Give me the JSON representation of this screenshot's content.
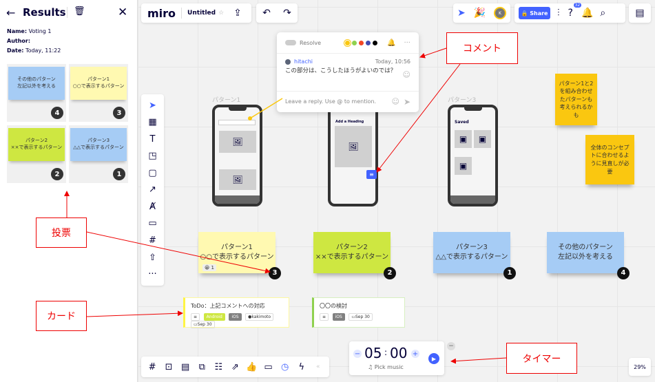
{
  "panel": {
    "title": "Results",
    "name_label": "Name:",
    "name_value": "Voting 1",
    "author_label": "Author:",
    "date_label": "Date:",
    "date_value": "Today, 11:22",
    "results": [
      {
        "text": "その他のパターン\n左記以外を考える",
        "rank": "4",
        "color": "#a6ccf5"
      },
      {
        "text": "パターン1\n○○で表示するパターン",
        "rank": "3",
        "color": "#fff9b1"
      },
      {
        "text": "パターン2\n××で表示するパターン",
        "rank": "2",
        "color": "#cee741"
      },
      {
        "text": "パターン3\n△△で表示するパターン",
        "rank": "1",
        "color": "#a6ccf5"
      }
    ]
  },
  "topbar": {
    "logo": "miro",
    "board_title": "Untitled",
    "share_label": "Share",
    "notification_count": "32",
    "avatar_initial": "K"
  },
  "comment": {
    "resolve_label": "Resolve",
    "colors": [
      "#fac710",
      "#8fd14f",
      "#f24726",
      "#414bb2",
      "#000000"
    ],
    "author": "hitachi",
    "time": "Today, 10:56",
    "text": "この部分は、こうしたほうがよいのでは？",
    "reply_placeholder": "Leave a reply. Use @ to mention."
  },
  "phones": {
    "label1": "パターン1",
    "label3": "パターン3",
    "heading2": "Add a Heading",
    "heading3": "Saved"
  },
  "stickies": [
    {
      "text": "パターン1\n○○で表示するパターン",
      "rank": "3",
      "color": "#fff9b1",
      "reaction": "1"
    },
    {
      "text": "パターン2\n××で表示するパターン",
      "rank": "2",
      "color": "#cee741"
    },
    {
      "text": "パターン3\n△△で表示するパターン",
      "rank": "1",
      "color": "#a6ccf5"
    },
    {
      "text": "その他のパターン\n左記以外を考える",
      "rank": "4",
      "color": "#a6ccf5"
    }
  ],
  "side_notes": [
    {
      "text": "パターン1と2を組み合わせたパターンも考えられるかも",
      "color": "#fac710"
    },
    {
      "text": "全体のコンセプトに合わせるように見直しが必要",
      "color": "#fac710"
    }
  ],
  "cards": [
    {
      "title": "ToDo：上記コメントへの対応",
      "tags": [
        "Android",
        "iOS"
      ],
      "assignee": "kakimoto",
      "date": "Sep 30",
      "color": "#fef445"
    },
    {
      "title": "〇〇の検討",
      "tags": [
        "iOS"
      ],
      "date": "Sep 30",
      "color": "#8fd14f"
    }
  ],
  "timer": {
    "minutes": "05",
    "seconds": "00",
    "music_label": "Pick music"
  },
  "zoom": "29%",
  "annotations": {
    "comment": "コメント",
    "vote": "投票",
    "card": "カード",
    "timer": "タイマー"
  }
}
